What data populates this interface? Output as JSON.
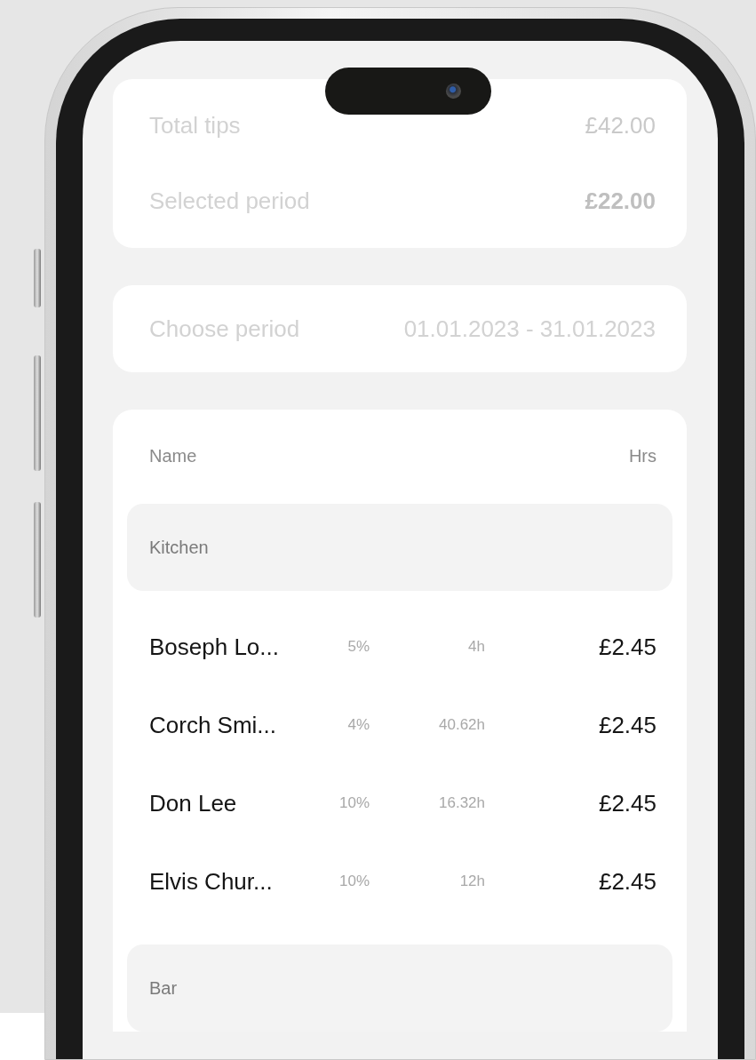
{
  "summary": [
    {
      "label": "Total tips",
      "value": "£42.00",
      "bold": false
    },
    {
      "label": "Selected period",
      "value": "£22.00",
      "bold": true
    }
  ],
  "period": {
    "label": "Choose period",
    "value": "01.01.2023 - 31.01.2023"
  },
  "table": {
    "columns": [
      "Name",
      "Hrs"
    ],
    "groups": [
      {
        "name": "Kitchen",
        "rows": [
          {
            "name": "Boseph Lo...",
            "share": "5%",
            "hours": "4h",
            "amount": "£2.45"
          },
          {
            "name": "Corch Smi...",
            "share": "4%",
            "hours": "40.62h",
            "amount": "£2.45"
          },
          {
            "name": "Don Lee",
            "share": "10%",
            "hours": "16.32h",
            "amount": "£2.45"
          },
          {
            "name": "Elvis Chur...",
            "share": "10%",
            "hours": "12h",
            "amount": "£2.45"
          }
        ]
      },
      {
        "name": "Bar"
      }
    ]
  }
}
